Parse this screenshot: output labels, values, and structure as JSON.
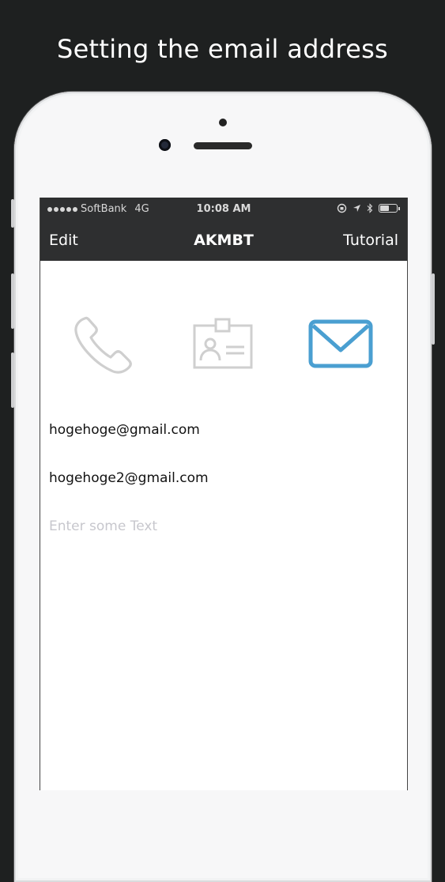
{
  "headline": "Setting the email address",
  "status_bar": {
    "carrier": "SoftBank",
    "network": "4G",
    "time": "10:08 AM"
  },
  "nav": {
    "left_label": "Edit",
    "title": "AKMBT",
    "right_label": "Tutorial"
  },
  "segments": [
    {
      "icon": "phone-icon",
      "selected": false
    },
    {
      "icon": "id-card-icon",
      "selected": false
    },
    {
      "icon": "envelope-icon",
      "selected": true
    }
  ],
  "emails": [
    "hogehoge@gmail.com",
    "hogehoge2@gmail.com"
  ],
  "new_email": {
    "value": "",
    "placeholder": "Enter some Text"
  },
  "colors": {
    "accent": "#4a9fd1",
    "inactive_icon": "#cfcfcf",
    "bar": "#2e2f30"
  }
}
